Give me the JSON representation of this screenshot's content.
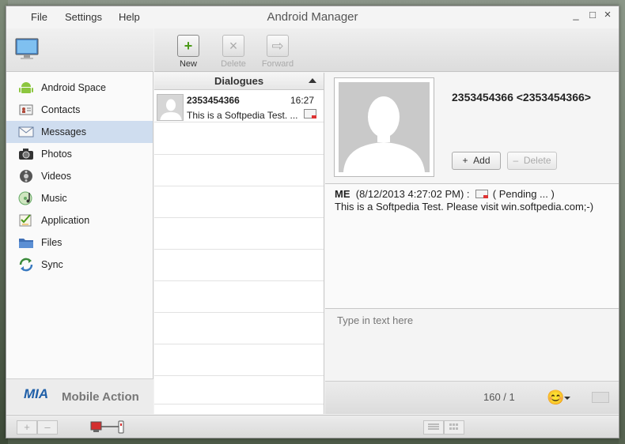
{
  "window": {
    "title": "Android Manager"
  },
  "menu": {
    "items": [
      "File",
      "Settings",
      "Help"
    ]
  },
  "window_controls": {
    "minimize": "_",
    "maximize": "□",
    "close": "×"
  },
  "sidebar": {
    "items": [
      {
        "label": "Android Space",
        "icon": "android-icon"
      },
      {
        "label": "Contacts",
        "icon": "contacts-icon"
      },
      {
        "label": "Messages",
        "icon": "envelope-icon",
        "active": true
      },
      {
        "label": "Photos",
        "icon": "camera-icon"
      },
      {
        "label": "Videos",
        "icon": "film-icon"
      },
      {
        "label": "Music",
        "icon": "music-icon"
      },
      {
        "label": "Application",
        "icon": "application-icon"
      },
      {
        "label": "Files",
        "icon": "folder-icon"
      },
      {
        "label": "Sync",
        "icon": "sync-icon"
      }
    ],
    "brand": {
      "logo": "MIA",
      "text": "Mobile Action"
    }
  },
  "toolbar": {
    "new_label": "New",
    "delete_label": "Delete",
    "forward_label": "Forward"
  },
  "dialogues": {
    "header": "Dialogues",
    "rows": [
      {
        "name": "2353454366",
        "time": "16:27",
        "preview": "This is a Softpedia Test. ..."
      }
    ]
  },
  "contact": {
    "name": "2353454366 <2353454366>",
    "add_label": "Add",
    "add_icon": "+",
    "delete_label": "Delete",
    "delete_icon": "–"
  },
  "message": {
    "sender": "ME",
    "timestamp": "(8/12/2013 4:27:02 PM) :",
    "status": "( Pending ... )",
    "body": "This is a Softpedia Test. Please visit win.softpedia.com;-)"
  },
  "compose": {
    "placeholder": "Type in text here"
  },
  "send_bar": {
    "counter": "160 / 1",
    "emoji": "😊"
  },
  "statusbar": {
    "add": "+",
    "remove": "–"
  },
  "colors": {
    "active_nav": "#cfddef",
    "brand_blue": "#1f5fa8",
    "android_green": "#8cc63f"
  }
}
